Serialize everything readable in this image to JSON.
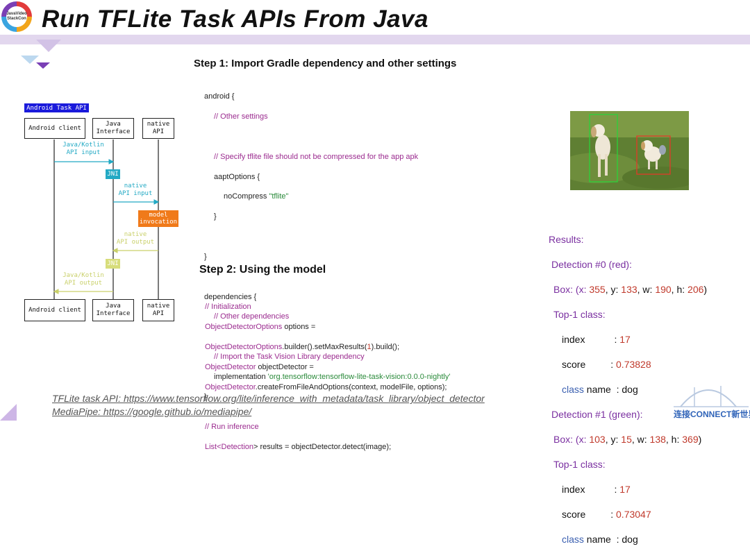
{
  "header": {
    "logo_text": "JavaVideo StackCon",
    "title": "Run TFLite Task APIs From Java"
  },
  "diagram": {
    "heading": "Android Task API",
    "top_boxes": [
      "Android client",
      "Java\nInterface",
      "native\nAPI"
    ],
    "bottom_boxes": [
      "Android client",
      "Java\nInterface",
      "native\nAPI"
    ],
    "java_kotlin_input": "Java/Kotlin\nAPI input",
    "jni_1": "JNI",
    "native_input": "native\nAPI input",
    "model_invocation": "model\ninvocation",
    "native_output": "native\nAPI output",
    "jni_2": "JNI",
    "java_kotlin_output": "Java/Kotlin\nAPI output",
    "colors": {
      "heading_bg": "#1a1adb",
      "jni_1": "#22a9c4",
      "model": "#f07a1a",
      "output": "#d7dd7a"
    }
  },
  "step1": {
    "heading": "Step 1: Import Gradle dependency and other settings",
    "lines": [
      "android {",
      "// Other settings",
      "",
      "// Specify tflite file should not be compressed for the app apk",
      "aaptOptions {",
      "noCompress",
      "\"tflite\"",
      "}",
      "}",
      "dependencies {",
      "// Other dependencies",
      "// Import the Task Vision Library dependency",
      "implementation",
      "'org.tensorflow:tensorflow-lite-task-vision:0.0.0-nightly'",
      "}"
    ]
  },
  "step2": {
    "heading": "Step 2: Using the model",
    "lines": [
      "// Initialization",
      "ObjectDetectorOptions",
      " options =",
      "ObjectDetectorOptions",
      ".builder().setMaxResults(",
      "1",
      ").build();",
      "ObjectDetector",
      " objectDetector =",
      "ObjectDetector",
      ".createFromFileAndOptions(context, modelFile, options);",
      "// Run inference",
      "List<",
      "Detection",
      "> results = objectDetector.detect(image);"
    ]
  },
  "results": {
    "title": "Results:",
    "detections": [
      {
        "label": "Detection #0 (red):",
        "box_prefix": "Box: (x: ",
        "x": "355",
        "y": "133",
        "w": "190",
        "h": "206",
        "top": "Top-1 class:",
        "index_label": "index",
        "index_value": "17",
        "score_label": "score",
        "score_value": "0.73828",
        "class_word": "class",
        "name_text": "name  : dog"
      },
      {
        "label": "Detection #1 (green):",
        "box_prefix": "Box: (x: ",
        "x": "103",
        "y": "15",
        "w": "138",
        "h": "369",
        "top": "Top-1 class:",
        "index_label": "index",
        "index_value": "17",
        "score_label": "score",
        "score_value": "0.73047",
        "class_word": "class",
        "name_text": "name  : dog"
      }
    ]
  },
  "links": {
    "tflite": "TFLite task API: https://www.tensorflow.org/lite/inference_with_metadata/task_library/object_detector",
    "mediapipe": "MediaPipe: https://google.github.io/mediapipe/"
  },
  "footer_logo": "连接CONNECT新世界",
  "photo": {
    "content": "two dogs on grass"
  }
}
